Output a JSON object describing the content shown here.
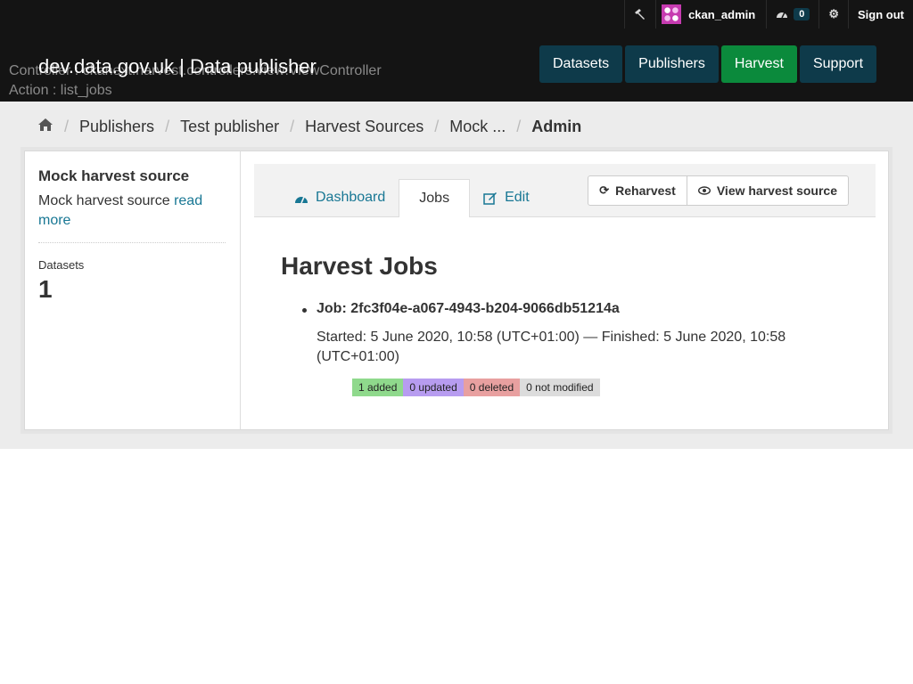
{
  "account": {
    "admin_icon": "hammer-icon",
    "username": "ckan_admin",
    "dashboard_icon": "dashboard-icon",
    "dashboard_count": "0",
    "settings_icon": "gear-icon",
    "signout_label": "Sign out"
  },
  "debug": {
    "controller": "Controller : ckanext.harvest.controllers.view:ViewController",
    "action": "Action : list_jobs"
  },
  "site_title": "dev.data.gov.uk | Data publisher",
  "nav": {
    "datasets": "Datasets",
    "publishers": "Publishers",
    "harvest": "Harvest",
    "support": "Support"
  },
  "breadcrumb": {
    "home_icon": "home-icon",
    "items": [
      "Publishers",
      "Test publisher",
      "Harvest Sources",
      "Mock ...",
      "Admin"
    ]
  },
  "sidebar": {
    "title": "Mock harvest source",
    "desc": "Mock harvest source ",
    "read_more": "read more",
    "datasets_label": "Datasets",
    "datasets_value": "1"
  },
  "tabs": {
    "dashboard": "Dashboard",
    "jobs": "Jobs",
    "edit": "Edit"
  },
  "actions": {
    "reharvest": "Reharvest",
    "view_source": "View harvest source"
  },
  "jobs": {
    "heading": "Harvest Jobs",
    "job_title": "Job: 2fc3f04e-a067-4943-b204-9066db51214a",
    "times": "Started: 5 June 2020, 10:58 (UTC+01:00) — Finished: 5 June 2020, 10:58 (UTC+01:00)",
    "stats": {
      "added": "1 added",
      "updated": "0 updated",
      "deleted": "0 deleted",
      "not_modified": "0 not modified"
    }
  },
  "colors": {
    "masthead": "#141414",
    "nav": "#0e3a4a",
    "nav_active": "#0b8a3c",
    "link": "#187794"
  }
}
